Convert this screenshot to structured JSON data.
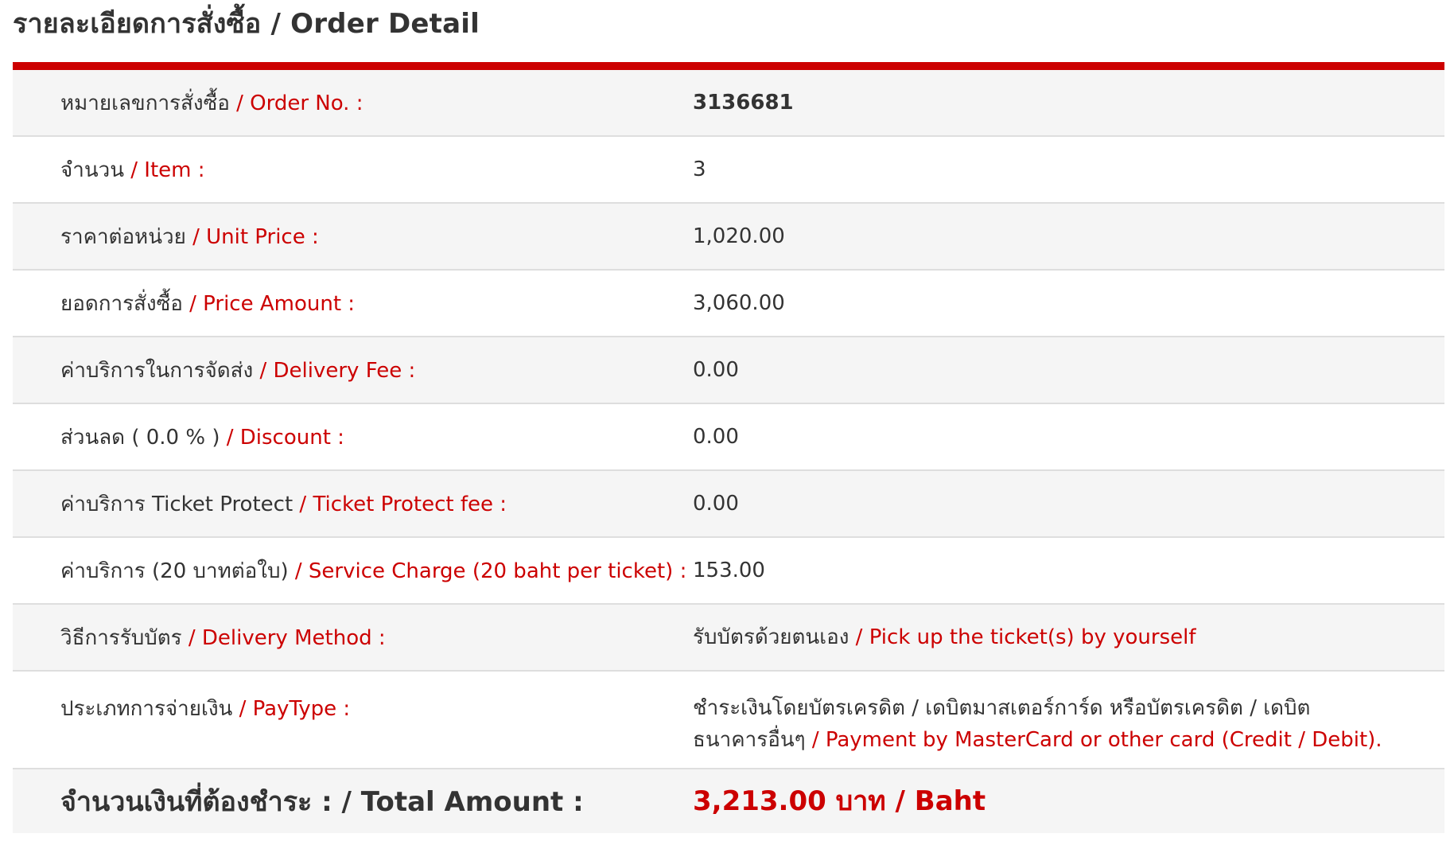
{
  "header": {
    "title": "รายละเอียดการสั่งซื้อ / Order Detail",
    "accent_color": "#cc0000"
  },
  "rows": [
    {
      "label_th": "หมายเลขการสั่งซื้อ",
      "label_en": " / Order No. :",
      "value": "3136681"
    },
    {
      "label_th": "จำนวน",
      "label_en": " / Item :",
      "value": "3"
    },
    {
      "label_th": "ราคาต่อหน่วย",
      "label_en": " / Unit Price :",
      "value": "1,020.00"
    },
    {
      "label_th": "ยอดการสั่งซื้อ",
      "label_en": " / Price Amount :",
      "value": "3,060.00"
    },
    {
      "label_th": "ค่าบริการในการจัดส่ง",
      "label_en": " / Delivery Fee :",
      "value": "0.00"
    },
    {
      "label_th": "ส่วนลด ( 0.0 % )",
      "label_en": " / Discount :",
      "value": "0.00"
    },
    {
      "label_th": "ค่าบริการ Ticket Protect",
      "label_en": " / Ticket Protect fee :",
      "value": "0.00"
    },
    {
      "label_th": "ค่าบริการ (20 บาทต่อใบ)",
      "label_en": " / Service Charge (20 baht per ticket) :",
      "value": "153.00"
    },
    {
      "label_th": "วิธีการรับบัตร",
      "label_en": " / Delivery Method :",
      "value_th": "รับบัตรด้วยตนเอง",
      "value_en": " / Pick up the ticket(s) by yourself"
    },
    {
      "label_th": "ประเภทการจ่ายเงิน",
      "label_en": " / PayType :",
      "value_th_line1": "ชำระเงินโดยบัตรเครดิต / เดบิตมาสเตอร์การ์ด หรือบัตรเครดิต / เดบิต",
      "value_th_line2": "ธนาคารอื่นๆ",
      "value_en": " / Payment by MasterCard or other card (Credit / Debit)."
    }
  ],
  "total": {
    "label": "จำนวนเงินที่ต้องชำระ : / Total Amount :",
    "value": "3,213.00 บาท / Baht"
  }
}
